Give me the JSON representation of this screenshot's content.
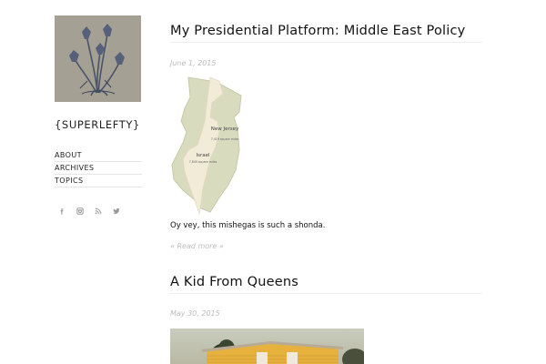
{
  "site": {
    "title": "{SUPERLEFTY}",
    "logo_icon": "flower-drawing-icon"
  },
  "nav": {
    "items": [
      "ABOUT",
      "ARCHIVES",
      "TOPICS"
    ]
  },
  "social": {
    "icons": [
      "facebook-icon",
      "instagram-icon",
      "rss-icon",
      "twitter-icon"
    ],
    "color": "#999999"
  },
  "posts": [
    {
      "title": "My Presidential Platform: Middle East Policy",
      "date": "June 1, 2015",
      "map_labels": {
        "new_jersey": "New Jersey",
        "new_jersey_area": "7,419 square miles",
        "israel": "Israel",
        "israel_area": "7,849 square miles"
      },
      "excerpt": "Oy vey, this mishegas is such a shonda.",
      "read_more": "« Read more »"
    },
    {
      "title": "A Kid From Queens",
      "date": "May 30, 2015"
    }
  ],
  "colors": {
    "date_text": "#bbbbbb",
    "map_nj": "#d9dbbf",
    "map_israel": "#f3ecd9"
  }
}
